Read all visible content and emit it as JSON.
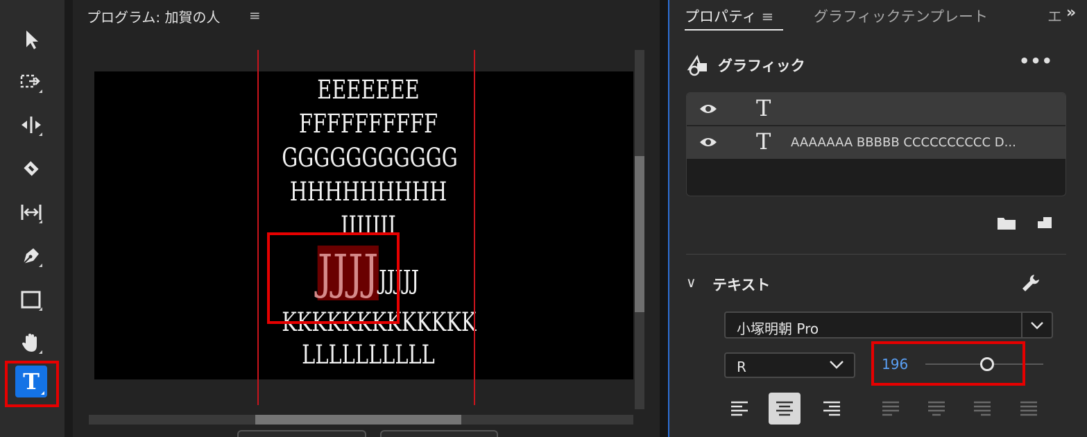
{
  "program": {
    "title": "プログラム: 加賀の人",
    "menu": "≡"
  },
  "monitor": {
    "lines": [
      "EEEEEEE",
      "FFFFFFFFFF",
      "GGGGGGGGGGG",
      "HHHHHHHHH",
      "IIIIIII"
    ],
    "selected_text": "JJJJ",
    "line_j_rest": "JJJJJ",
    "line_k": "KKKKKKKKKKKKK",
    "line_l": "LLLLLLLLLL"
  },
  "properties": {
    "tabs": [
      "プロパティ",
      "グラフィックテンプレート",
      "エ"
    ],
    "tab_menu": "≡",
    "more_tabs": "»",
    "graphic_title": "グラフィック",
    "graphic_more": "•••",
    "layers": [
      {
        "label": ""
      },
      {
        "label": "AAAAAAA BBBBB CCCCCCCCCC D..."
      }
    ],
    "text_section_title": "テキスト",
    "text_section_chevron": "∨",
    "font_family": "小塚明朝 Pro",
    "font_style": "R",
    "font_size": "196"
  },
  "colors": {
    "accent": "#1473e6",
    "highlight": "#e60000",
    "guide": "#c8141c",
    "size_value": "#5aa0f5"
  }
}
